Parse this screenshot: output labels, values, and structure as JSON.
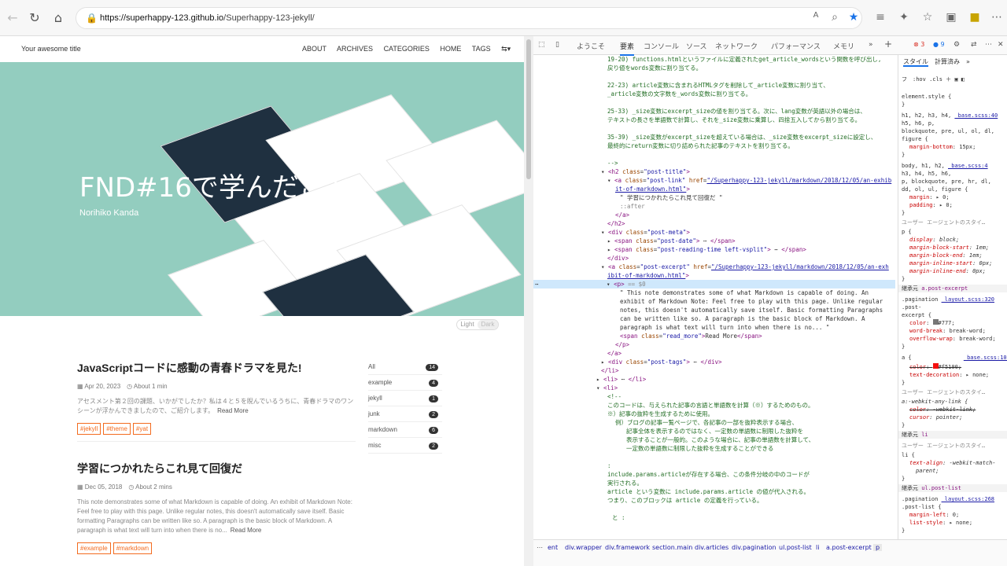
{
  "browser": {
    "url_host": "https://superhappy-123.github.io",
    "url_path": "/Superhappy-123-jekyll/"
  },
  "site": {
    "logo": "Your awesome title",
    "nav": [
      "ABOUT",
      "ARCHIVES",
      "CATEGORIES",
      "HOME",
      "TAGS"
    ],
    "hero": {
      "title": "FND#16で学んだこと",
      "author": "Norihiko Kanda"
    },
    "theme": {
      "light": "Light",
      "dark": "Dark"
    },
    "posts": [
      {
        "title": "JavaScriptコードに感動の青春ドラマを見た!",
        "date": "Apr 20, 2023",
        "reading": "About 1 min",
        "excerpt": "アセスメント第２回の課題、いかがでしたか？私は４と５を睨んでいるうちに、青春ドラマのワンシーンが浮かんできましたので、ご紹介します。",
        "more": "Read More",
        "tags": [
          "#jekyll",
          "#theme",
          "#yat"
        ]
      },
      {
        "title": "学習につかれたらこれ見て回復だ",
        "date": "Dec 05, 2018",
        "reading": "About 2 mins",
        "excerpt": "This note demonstrates some of what Markdown is capable of doing. An exhibit of Markdown Note: Feel free to play with this page. Unlike regular notes, this doesn't automatically save itself. Basic formatting Paragraphs can be written like so. A paragraph is the basic block of Markdown. A paragraph is what text will turn into when there is no...",
        "more": "Read More",
        "tags": [
          "#example",
          "#markdown"
        ]
      }
    ],
    "categories": [
      {
        "name": "All",
        "count": "14"
      },
      {
        "name": "example",
        "count": "4"
      },
      {
        "name": "jekyll",
        "count": "1"
      },
      {
        "name": "junk",
        "count": "2"
      },
      {
        "name": "markdown",
        "count": "6"
      },
      {
        "name": "misc",
        "count": "2"
      }
    ]
  },
  "devtools": {
    "tabs": [
      "ようこそ",
      "要素",
      "コンソール",
      "ソース",
      "ネットワーク",
      "パフォーマンス",
      "メモリ"
    ],
    "errors": "3",
    "messages": "9",
    "style_tabs": [
      "スタイル",
      "計算済み"
    ],
    "filter": {
      "hov": ":hov",
      "cls": ".cls"
    },
    "breadcrumb": [
      "ent",
      "div.wrapper",
      "div.framework",
      "section.main",
      "div.articles",
      "div.pagination",
      "ul.post-list",
      "li",
      "a.post-excerpt",
      "p"
    ]
  }
}
